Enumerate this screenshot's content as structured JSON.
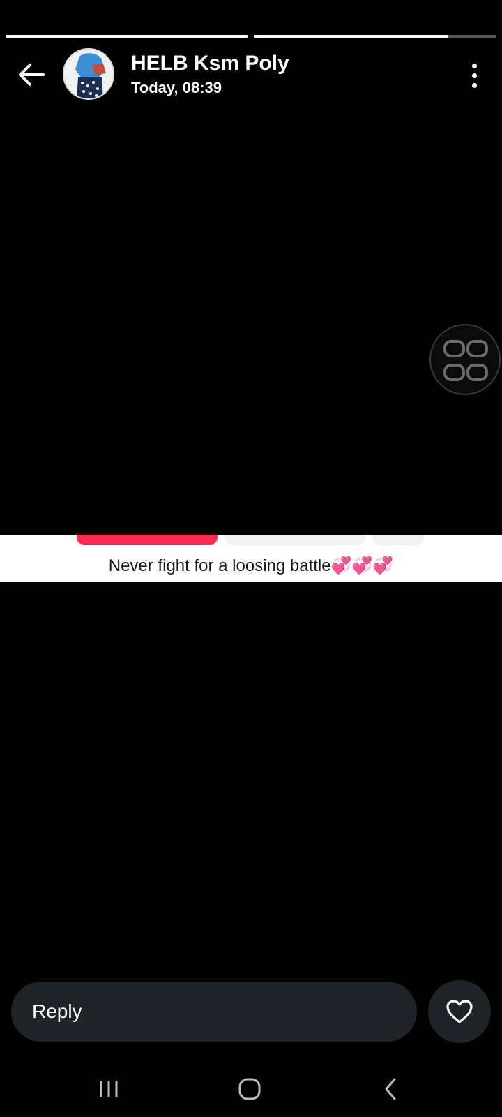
{
  "progress": [
    {
      "fill_fraction": 1.0
    },
    {
      "fill_fraction": 0.8
    }
  ],
  "header": {
    "title": "HELB Ksm Poly",
    "subtitle": "Today, 08:39",
    "back_icon": "arrow-left-icon",
    "menu_icon": "more-vertical-icon"
  },
  "media": {
    "caption": "Never fight for a loosing battle💞💞💞",
    "accent_color": "#fe2c55"
  },
  "reply": {
    "placeholder": "Reply",
    "like_icon": "heart-outline-icon"
  },
  "floating": {
    "icon": "grid-icon"
  },
  "system_nav": {
    "recent_icon": "recent-apps-icon",
    "home_icon": "home-icon",
    "back_icon": "back-chevron-icon"
  }
}
